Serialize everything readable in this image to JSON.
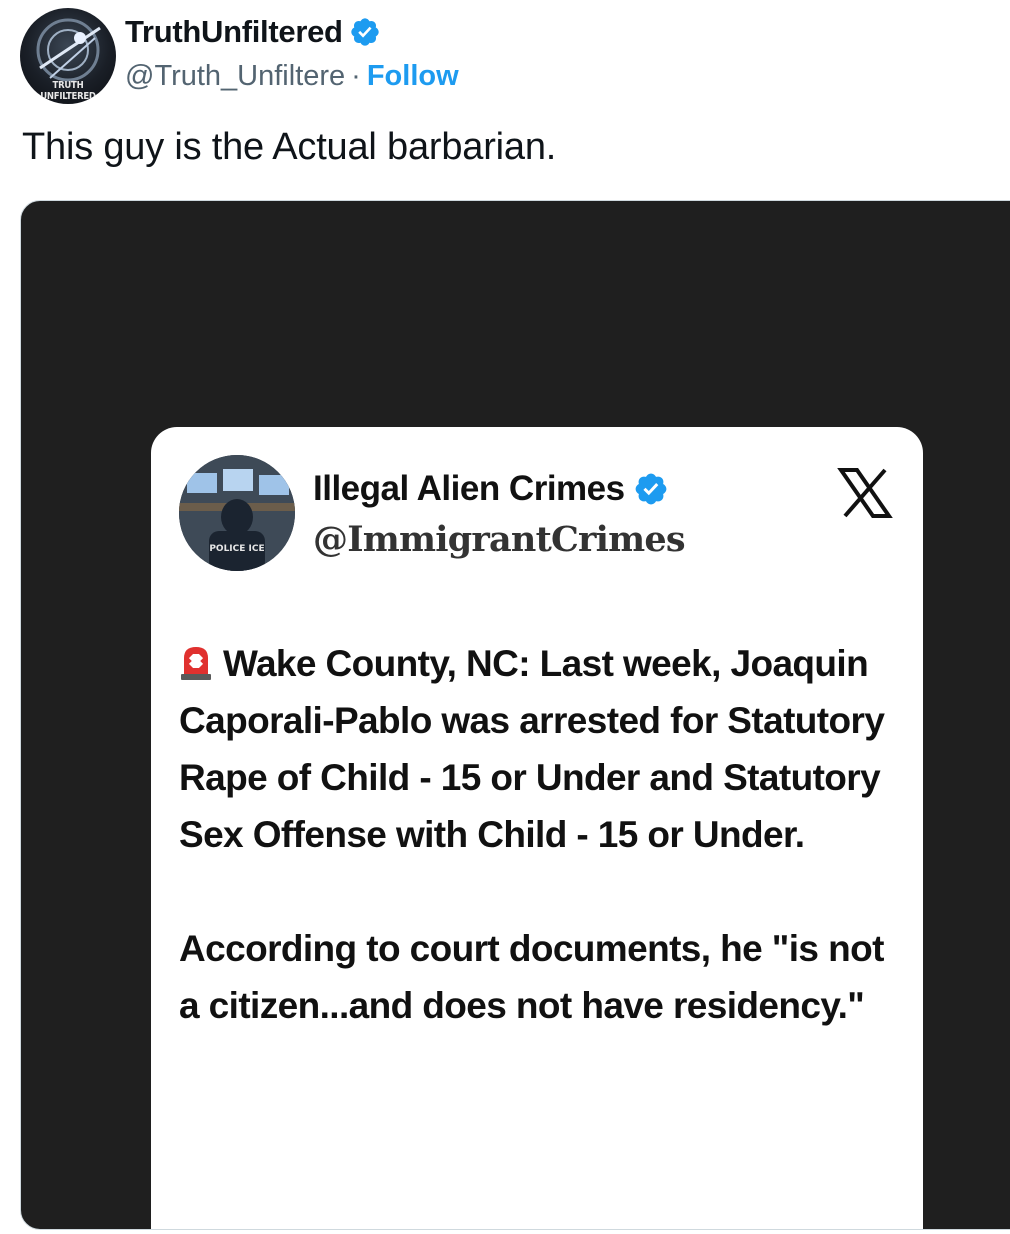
{
  "post": {
    "avatar_text": "TRUTH UNFILTERED",
    "display_name": "TruthUnfiltered",
    "handle": "@Truth_Unfiltere",
    "separator": "·",
    "follow_label": "Follow",
    "text": "This guy is the Actual barbarian."
  },
  "embedded_card": {
    "display_name": "Illegal Alien Crimes",
    "handle": "@ImmigrantCrimes",
    "avatar_text": "POLICE ICE",
    "paragraph1": "Wake County, NC: Last week, Joaquin Caporali-Pablo was arrested for Statutory Rape of Child - 15 or Under and Statutory Sex Offense with Child - 15 or Under.",
    "paragraph2": "According to court documents, he \"is not a citizen...and does not have residency.\""
  },
  "colors": {
    "link": "#1d9bf0",
    "verified": "#1d9bf0",
    "media_bg": "#1f1f1f",
    "muted": "#536471"
  },
  "icons": [
    "verified-badge-icon",
    "x-logo-icon",
    "siren-emoji-icon"
  ]
}
